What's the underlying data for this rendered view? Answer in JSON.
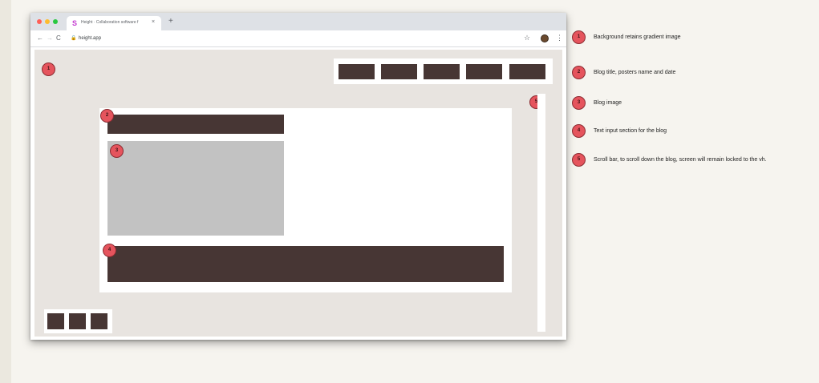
{
  "browser": {
    "tab_title": "Height · Collaboration software f",
    "tab_favicon": "S",
    "tab_close": "×",
    "new_tab": "+",
    "url": "height.app",
    "icons": {
      "back": "←",
      "forward": "→",
      "reload": "C",
      "lock": "🔒",
      "star": "☆",
      "menu": "⋮"
    }
  },
  "colors": {
    "block_dark": "#473634",
    "image_placeholder": "#c2c2c2",
    "viewport_bg": "#e8e4e0",
    "marker": "#e5545d"
  },
  "markers": {
    "background": "1",
    "title": "2",
    "image": "3",
    "text": "4",
    "scrollbar": "5"
  },
  "legend": [
    {
      "number": "1",
      "text": "Background retains gradient image"
    },
    {
      "number": "2",
      "text": "Blog title, posters name and date"
    },
    {
      "number": "3",
      "text": "Blog image"
    },
    {
      "number": "4",
      "text": "Text input section for the blog"
    },
    {
      "number": "5",
      "text": "Scroll bar, to scroll down the blog, screen will remain locked to the vh."
    }
  ]
}
